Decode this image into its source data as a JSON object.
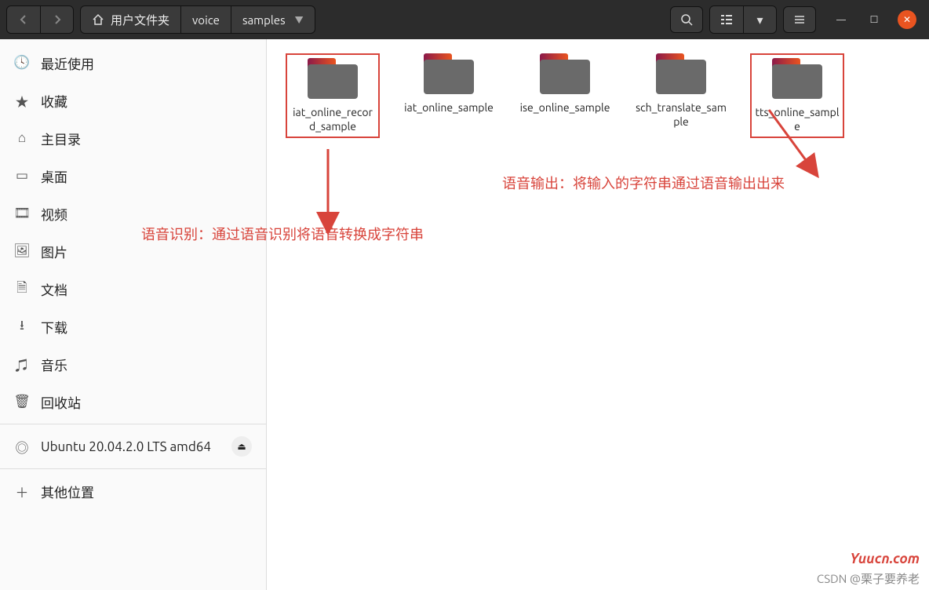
{
  "breadcrumb": {
    "home": "用户文件夹",
    "p1": "voice",
    "p2": "samples"
  },
  "sidebar": {
    "items": [
      {
        "label": "最近使用"
      },
      {
        "label": "收藏"
      },
      {
        "label": "主目录"
      },
      {
        "label": "桌面"
      },
      {
        "label": "视频"
      },
      {
        "label": "图片"
      },
      {
        "label": "文档"
      },
      {
        "label": "下载"
      },
      {
        "label": "音乐"
      },
      {
        "label": "回收站"
      }
    ],
    "disk": "Ubuntu 20.04.2.0 LTS amd64",
    "other": "其他位置"
  },
  "folders": [
    {
      "name": "iat_online_record_sample",
      "highlight": true
    },
    {
      "name": "iat_online_sample"
    },
    {
      "name": "ise_online_sample"
    },
    {
      "name": "sch_translate_sample"
    },
    {
      "name": "tts_online_sample",
      "highlight": true
    }
  ],
  "annotations": {
    "left": "语音识别：通过语音识别将语音转换成字符串",
    "right": "语音输出：将输入的字符串通过语音输出出来"
  },
  "watermarks": {
    "site": "Yuucn.com",
    "csdn": "CSDN @栗子要养老"
  }
}
